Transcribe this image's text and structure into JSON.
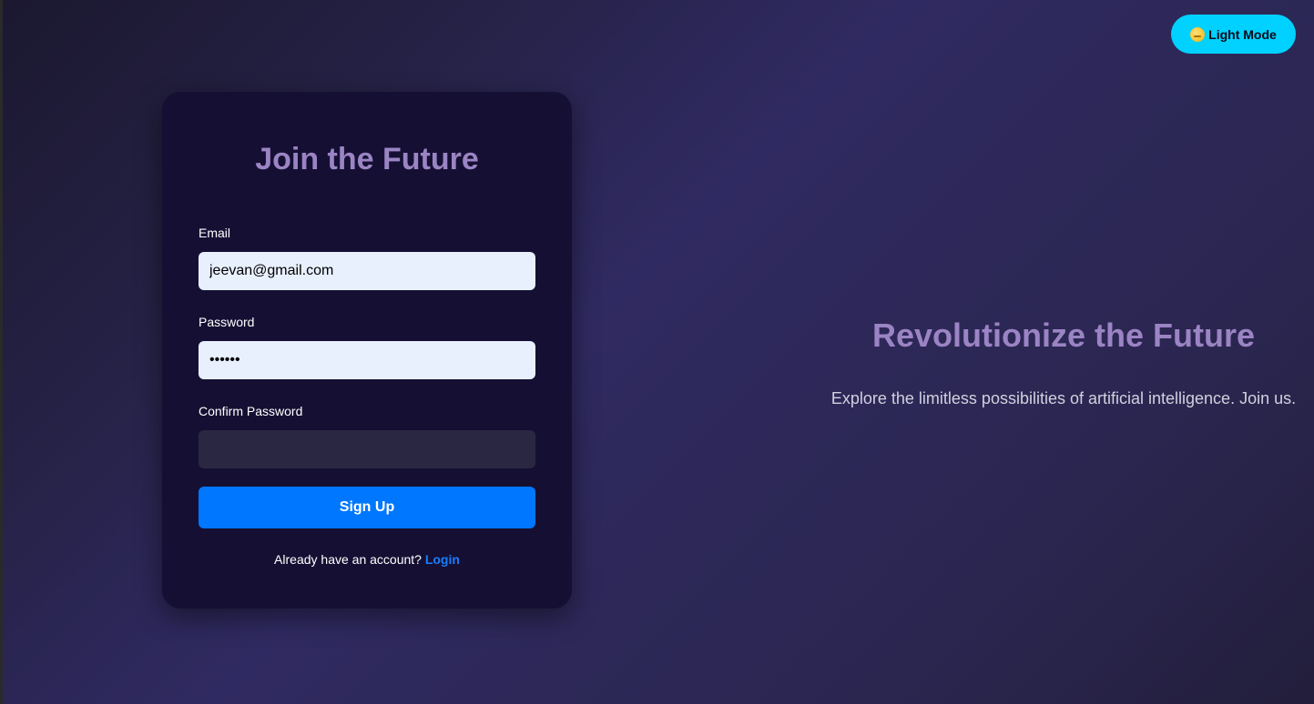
{
  "theme_toggle": {
    "icon": "sun-icon",
    "label": "Light Mode",
    "color": "#00d1ff"
  },
  "signup_card": {
    "title": "Join the Future",
    "fields": [
      {
        "label": "Email",
        "value": "jeevan@gmail.com",
        "type": "email"
      },
      {
        "label": "Password",
        "value": "••••••",
        "type": "password"
      },
      {
        "label": "Confirm Password",
        "value": "",
        "type": "password"
      }
    ],
    "submit_label": "Sign Up",
    "footer_text": "Already have an account?",
    "login_link": "Login"
  },
  "hero": {
    "title": "Revolutionize the Future",
    "subtitle": "Explore the limitless possibilities of artificial intelligence. Join us."
  },
  "colors": {
    "accent": "#0077ff",
    "title": "#9b84c4",
    "card_bg": "#151033",
    "toggle": "#00d1ff"
  }
}
